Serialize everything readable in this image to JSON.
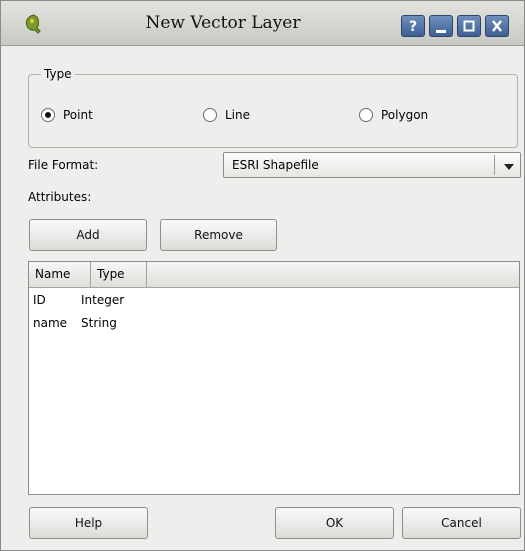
{
  "window": {
    "title": "New Vector Layer",
    "buttons": {
      "help": "?",
      "minimize": "minimize",
      "maximize": "maximize",
      "close": "close"
    }
  },
  "type_group": {
    "title": "Type",
    "options": [
      {
        "label": "Point",
        "selected": true
      },
      {
        "label": "Line",
        "selected": false
      },
      {
        "label": "Polygon",
        "selected": false
      }
    ]
  },
  "file_format": {
    "label": "File Format:",
    "value": "ESRI Shapefile"
  },
  "attributes": {
    "label": "Attributes:",
    "add_label": "Add",
    "remove_label": "Remove",
    "columns": [
      "Name",
      "Type"
    ],
    "rows": [
      {
        "name": "ID",
        "type": "Integer"
      },
      {
        "name": "name",
        "type": "String"
      }
    ]
  },
  "footer": {
    "help_label": "Help",
    "ok_label": "OK",
    "cancel_label": "Cancel"
  },
  "colors": {
    "title_button": "#4a6ba0",
    "window_bg": "#eeeeec"
  },
  "icons": {
    "app": "qgis-icon",
    "dropdown": "chevron-down-icon"
  }
}
